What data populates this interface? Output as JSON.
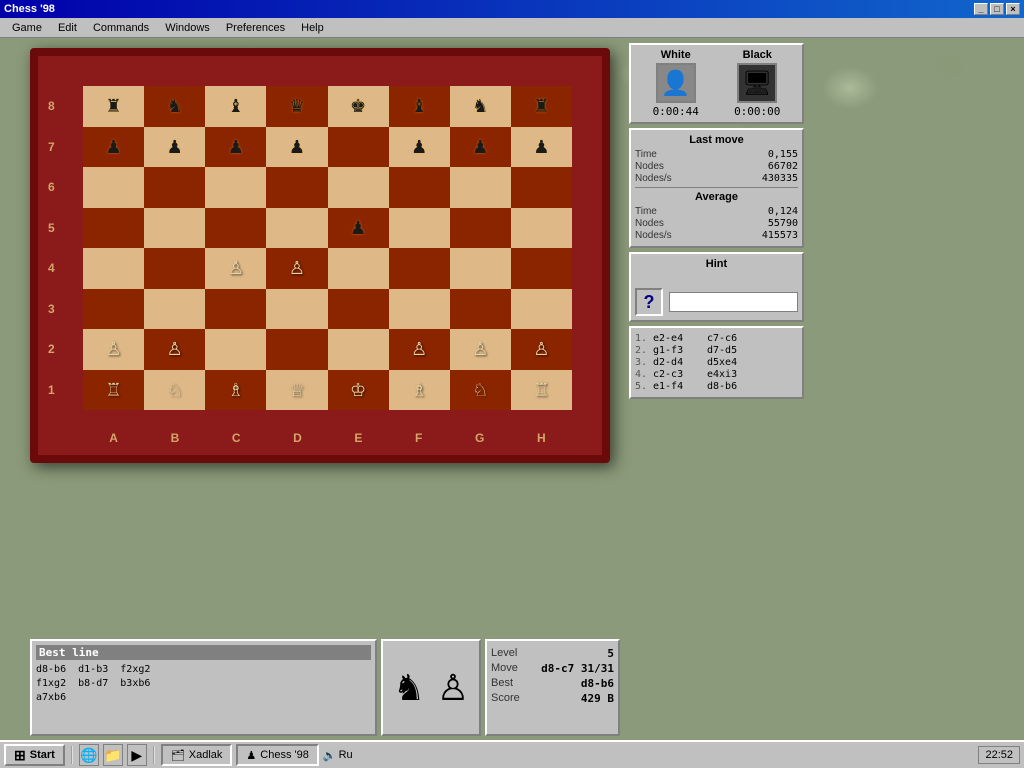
{
  "title_bar": {
    "title": "Chess '98",
    "buttons": [
      "_",
      "□",
      "×"
    ]
  },
  "menu": {
    "items": [
      "Game",
      "Edit",
      "Commands",
      "Windows",
      "Preferences",
      "Help"
    ]
  },
  "players": {
    "white": {
      "label": "White",
      "avatar": "♟",
      "time": "0:00:44"
    },
    "black": {
      "label": "Black",
      "avatar": "🖥",
      "time": "0:00:00"
    }
  },
  "stats": {
    "panel_title": "Last move",
    "last_move": {
      "time_label": "Time",
      "time_val": "0,155",
      "nodes_label": "Nodes",
      "nodes_val": "66702",
      "nodes_s_label": "Nodes/s",
      "nodes_s_val": "430335"
    },
    "average": {
      "title": "Average",
      "time_label": "Time",
      "time_val": "0,124",
      "nodes_label": "Nodes",
      "nodes_val": "55790",
      "nodes_s_label": "Nodes/s",
      "nodes_s_val": "415573"
    }
  },
  "hint": {
    "title": "Hint",
    "icon": "?"
  },
  "moves": {
    "list": [
      {
        "num": "1.",
        "white": "e2-e4",
        "black": "c7-c6"
      },
      {
        "num": "2.",
        "white": "g1-f3",
        "black": "d7-d5"
      },
      {
        "num": "3.",
        "white": "d2-d4",
        "black": "d5xe4"
      },
      {
        "num": "4.",
        "white": "c2-c3",
        "black": "e4xi3"
      },
      {
        "num": "5.",
        "white": "e1-f4",
        "black": "d8-b6"
      }
    ]
  },
  "best_line": {
    "title": "Best line",
    "content": "d8-b6  d1-b3  f2xg2\nf1xg2  b8-d7  b3xb6\na7xb6"
  },
  "level_panel": {
    "level_label": "Level",
    "level_val": "5",
    "move_label": "Move",
    "move_val": "d8-c7  31/31",
    "best_label": "Best",
    "best_val": "d8-b6",
    "score_label": "Score",
    "score_val": "429 B"
  },
  "board": {
    "files": [
      "A",
      "B",
      "C",
      "D",
      "E",
      "F",
      "G",
      "H"
    ],
    "ranks": [
      "8",
      "7",
      "6",
      "5",
      "4",
      "3",
      "2",
      "1"
    ],
    "cells": [
      [
        "♜",
        "♞",
        "♝",
        "♛",
        "♚",
        "♝",
        "♞",
        "♜"
      ],
      [
        "♟",
        "♟",
        "♟",
        "♟",
        "",
        "♟",
        "♟",
        "♟"
      ],
      [
        "",
        "",
        "",
        "",
        "",
        "",
        "",
        ""
      ],
      [
        "",
        "",
        "",
        "",
        "♟",
        "",
        "",
        ""
      ],
      [
        "",
        "",
        "♙",
        "♙",
        "",
        "",
        "",
        ""
      ],
      [
        "",
        "",
        "",
        "",
        "",
        "",
        "",
        ""
      ],
      [
        "♙",
        "♙",
        "",
        "",
        "",
        "♙",
        "♙",
        "♙"
      ],
      [
        "♖",
        "♘",
        "♗",
        "♕",
        "♔",
        "♗",
        "♘",
        "♖"
      ]
    ],
    "colors": [
      [
        1,
        0,
        1,
        0,
        1,
        0,
        1,
        0
      ],
      [
        0,
        1,
        0,
        1,
        0,
        1,
        0,
        1
      ],
      [
        1,
        0,
        1,
        0,
        1,
        0,
        1,
        0
      ],
      [
        0,
        1,
        0,
        1,
        0,
        1,
        0,
        1
      ],
      [
        1,
        0,
        1,
        0,
        1,
        0,
        1,
        0
      ],
      [
        0,
        1,
        0,
        1,
        0,
        1,
        0,
        1
      ],
      [
        1,
        0,
        1,
        0,
        1,
        0,
        1,
        0
      ],
      [
        0,
        1,
        0,
        1,
        0,
        1,
        0,
        1
      ]
    ]
  },
  "taskbar": {
    "start_label": "Start",
    "apps": [
      {
        "label": "Xadlak",
        "icon": "🗂"
      },
      {
        "label": "Chess '98",
        "icon": "♟"
      }
    ],
    "clock": "22:52",
    "tray_icon": "🔊"
  }
}
